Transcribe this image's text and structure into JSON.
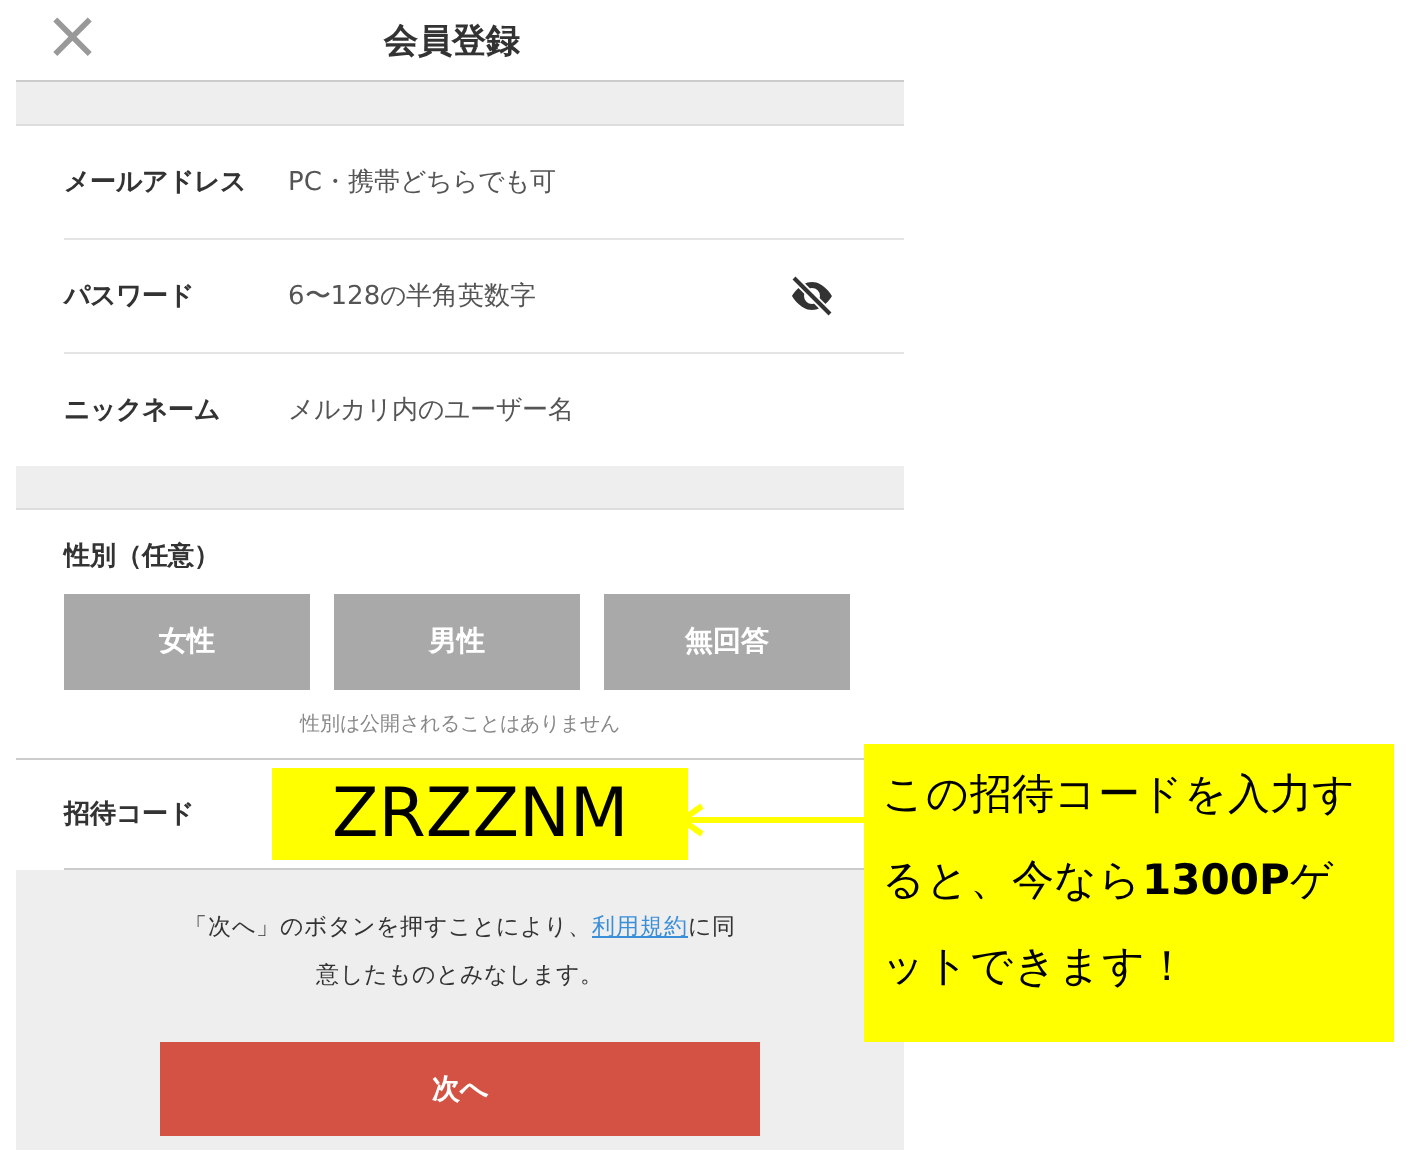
{
  "header": {
    "close": "×",
    "title": "会員登録"
  },
  "fields": [
    {
      "label": "メールアドレス",
      "placeholder": "PC・携帯どちらでも可"
    },
    {
      "label": "パスワード",
      "placeholder": "6〜128の半角英数字",
      "kind": "password"
    },
    {
      "label": "ニックネーム",
      "placeholder": "メルカリ内のユーザー名"
    }
  ],
  "gender": {
    "label": "性別（任意）",
    "options": [
      {
        "label": "女性",
        "selected": false
      },
      {
        "label": "男性",
        "selected": false
      },
      {
        "label": "無回答",
        "selected": false
      }
    ],
    "note": "性別は公開されることはありません"
  },
  "invite": {
    "label": "招待コード",
    "value": "ZRZZNM"
  },
  "terms": {
    "before": "「次へ」のボタンを押すことにより、",
    "link": "利用規約",
    "after": "に同意したものとみなします。"
  },
  "next_button": "次へ",
  "callout": "この招待コードを入力すると、今なら**1300P**ゲットできます！"
}
